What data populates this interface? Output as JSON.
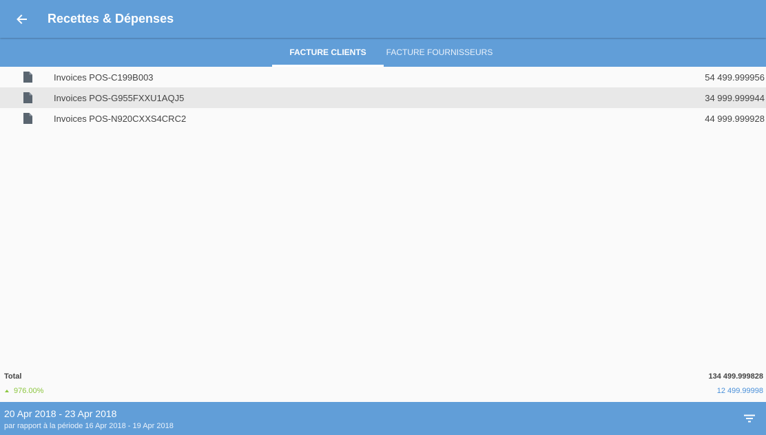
{
  "appbar": {
    "title": "Recettes & Dépenses",
    "back_icon": "arrow-left-icon"
  },
  "tabs": [
    {
      "label": "FACTURE CLIENTS",
      "active": true
    },
    {
      "label": "FACTURE FOURNISSEURS",
      "active": false
    }
  ],
  "invoices": [
    {
      "icon": "document-icon",
      "label": "Invoices POS-C199B003",
      "amount": "54 499.999956"
    },
    {
      "icon": "document-icon",
      "label": "Invoices POS-G955FXXU1AQJ5",
      "amount": "34 999.999944"
    },
    {
      "icon": "document-icon",
      "label": "Invoices POS-N920CXXS4CRC2",
      "amount": "44 999.999928"
    }
  ],
  "summary": {
    "total_label": "Total",
    "total_amount": "134 499.999828",
    "trend_percent": "976.00%",
    "previous_amount": "12 499.99998"
  },
  "footer": {
    "date_range": "20 Apr 2018 - 23 Apr 2018",
    "comparison": "par rapport à la période 16 Apr 2018 - 19 Apr 2018",
    "filter_icon": "filter-icon"
  },
  "colors": {
    "primary": "#619ed8",
    "trend_up": "#8cc63f",
    "previous_amount": "#4a90d9",
    "text": "#444444"
  }
}
